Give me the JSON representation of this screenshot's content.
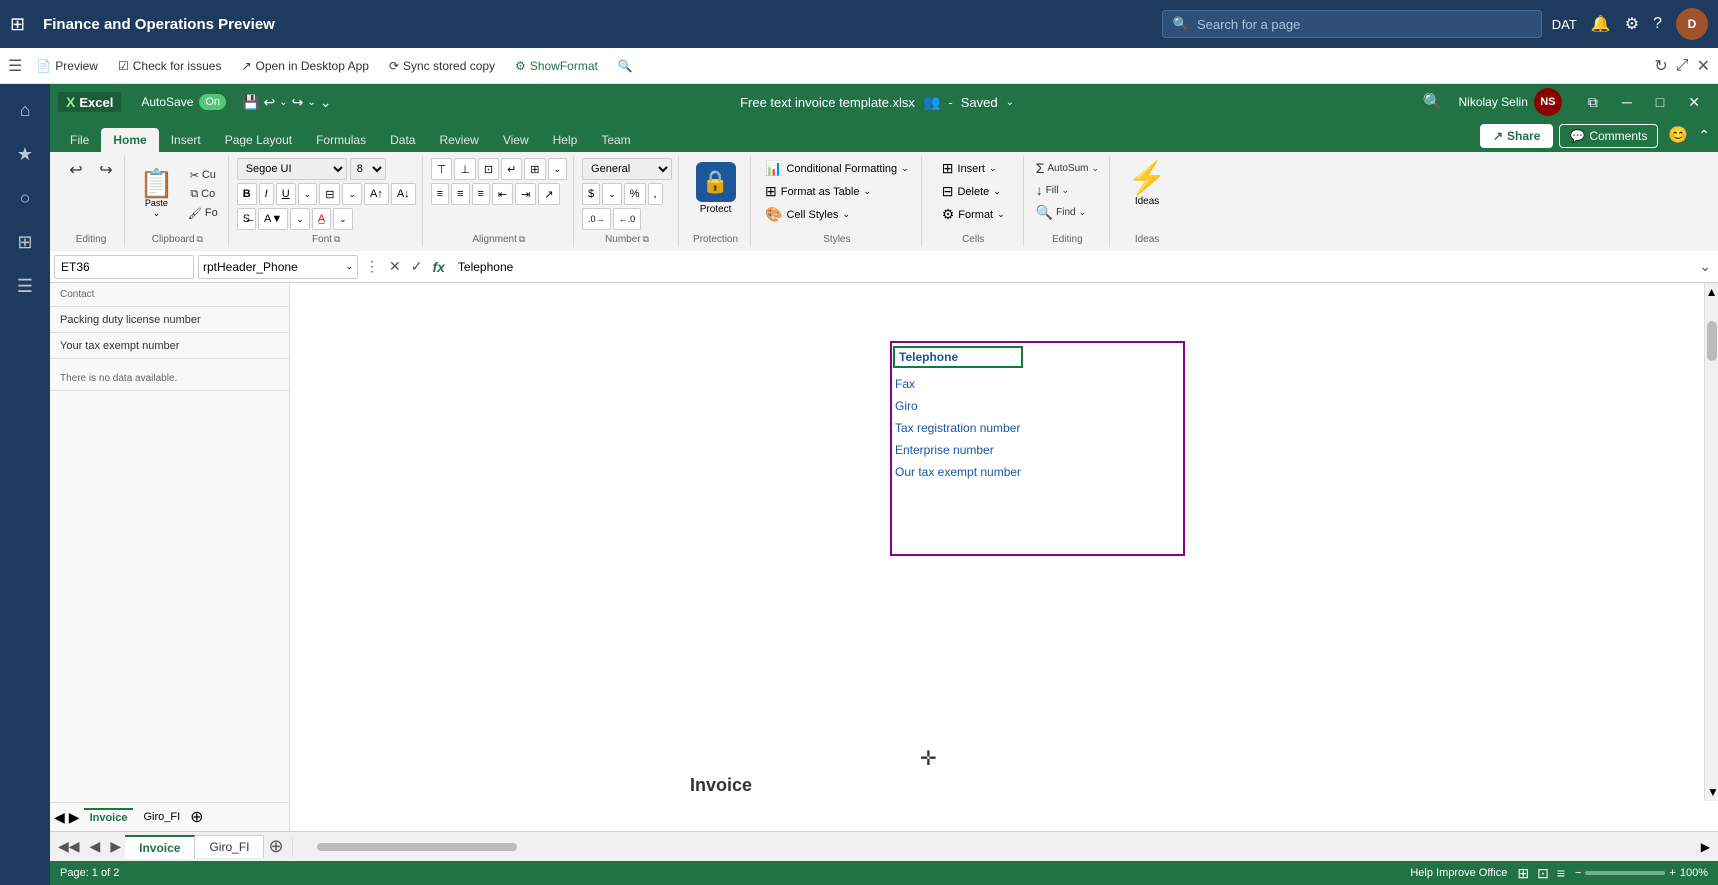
{
  "topNav": {
    "waffle": "⊞",
    "title": "Finance and Operations Preview",
    "searchPlaceholder": "Search for a page",
    "userInitials": "DAT",
    "notificationIcon": "🔔",
    "settingsIcon": "⚙",
    "helpIcon": "?",
    "avatarAlt": "User avatar"
  },
  "secondToolbar": {
    "menuIcon": "☰",
    "preview": "Preview",
    "checkIssues": "Check for issues",
    "openDesktop": "Open in Desktop App",
    "syncStored": "Sync stored copy",
    "showFormat": "ShowFormat",
    "refreshIcon": "↻",
    "expandIcon": "⤢",
    "closeIcon": "✕"
  },
  "excelTitleBar": {
    "logoIcon": "X",
    "appName": "Excel",
    "autoSave": "AutoSave",
    "toggleOn": "On",
    "undoIcon": "↩",
    "redoIcon": "↪",
    "moreIcon": "⌄",
    "fileName": "Free text invoice template.xlsx",
    "savedLabel": "Saved",
    "userIcon": "👤",
    "searchIcon": "🔍",
    "userName": "Nikolay Selin",
    "userInitials": "NS",
    "restoreIcon": "⧉",
    "minimizeIcon": "─",
    "maximizeIcon": "□",
    "closeIcon": "✕"
  },
  "ribbonTabs": {
    "tabs": [
      {
        "label": "File",
        "active": false
      },
      {
        "label": "Home",
        "active": true
      },
      {
        "label": "Insert",
        "active": false
      },
      {
        "label": "Page Layout",
        "active": false
      },
      {
        "label": "Formulas",
        "active": false
      },
      {
        "label": "Data",
        "active": false
      },
      {
        "label": "Review",
        "active": false
      },
      {
        "label": "View",
        "active": false
      },
      {
        "label": "Help",
        "active": false
      },
      {
        "label": "Team",
        "active": false
      }
    ],
    "shareLabel": "Share",
    "commentsLabel": "Comments",
    "collapseIcon": "⌃"
  },
  "ribbonGroups": {
    "clipboard": {
      "label": "Clipboard",
      "pasteLabel": "Paste",
      "cutLabel": "Cu",
      "copyLabel": "Co",
      "formatPainterLabel": "Fo"
    },
    "font": {
      "label": "Font",
      "fontName": "Segoe UI",
      "fontSize": "8",
      "boldLabel": "B",
      "italicLabel": "I",
      "underlineLabel": "U",
      "increaseFontLabel": "A↑",
      "decreaseFontLabel": "A↓"
    },
    "alignment": {
      "label": "Alignment"
    },
    "number": {
      "label": "Number",
      "format": "General"
    },
    "styles": {
      "label": "Styles",
      "conditionalFormatting": "Conditional Formatting",
      "formatAsTable": "Format as Table",
      "cellStyles": "Cell Styles"
    },
    "cells": {
      "label": "Cells",
      "insertLabel": "Insert",
      "deleteLabel": "Delete",
      "formatLabel": "Format"
    },
    "editing": {
      "label": "Editing"
    },
    "protect": {
      "label": "Protection",
      "buttonLabel": "Protect"
    },
    "ideas": {
      "label": "Ideas",
      "buttonLabel": "Ideas"
    }
  },
  "formulaBar": {
    "nameBox": "ET36",
    "nameBoxDropdown": "rptHeader_Phone",
    "cancelIcon": "✕",
    "confirmIcon": "✓",
    "fxIcon": "fx",
    "formula": "Telephone",
    "expandIcon": "⌄"
  },
  "outerSidebar": {
    "icons": [
      "⌂",
      "★",
      "○",
      "⊞",
      "☰"
    ]
  },
  "leftPanel": {
    "items": [
      {
        "label": "Contact",
        "value": ""
      },
      {
        "label": "Packing duty license number",
        "value": ""
      },
      {
        "label": "Your tax exempt number",
        "value": ""
      },
      {
        "label": "There is no data available.",
        "value": ""
      }
    ]
  },
  "spreadsheet": {
    "selectedCell": "Telephone",
    "cellList": [
      "Fax",
      "Giro",
      "Tax registration number",
      "Enterprise number",
      "Our tax exempt number"
    ],
    "invoiceTitle": "Invoice",
    "crossCursor": "✛"
  },
  "sheetTabs": {
    "tabs": [
      {
        "label": "Invoice",
        "active": true
      },
      {
        "label": "Giro_FI",
        "active": false
      }
    ],
    "addIcon": "+",
    "pageInfo": "Page: 1 of 2"
  },
  "statusBar": {
    "pageInfo": "Page: 1 of 2",
    "zoomLevel": "100%",
    "helpImprove": "Help Improve Office"
  }
}
